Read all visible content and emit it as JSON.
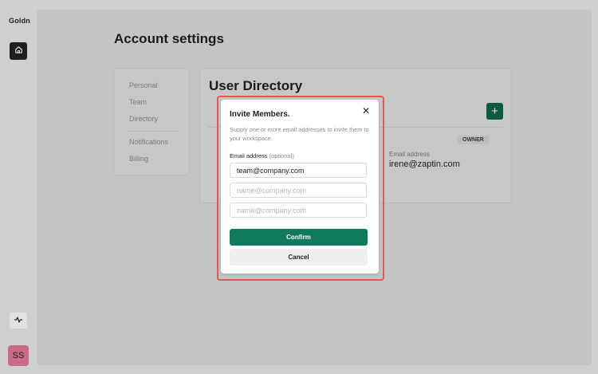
{
  "app": {
    "logo": "Goldn"
  },
  "sidebar": {
    "home_icon": "home-icon",
    "activity_icon": "activity-icon",
    "avatar_initials": "SS",
    "avatar_color": "#c96b84"
  },
  "page": {
    "title": "Account settings"
  },
  "settings_nav": {
    "items": [
      "Personal",
      "Team",
      "Directory",
      "Notifications",
      "Billing"
    ]
  },
  "directory": {
    "title": "User Directory",
    "add_button": "+",
    "owner_badge": "OWNER",
    "email_label": "Email address",
    "email_value": "irene@zaptin.com"
  },
  "modal": {
    "title": "Invite Members.",
    "close": "✕",
    "description": "Supply one or more email addresses to invite them to your workspace.",
    "field_label": "Email address",
    "field_optional": "(optional)",
    "inputs": [
      {
        "value": "team@company.com",
        "placeholder": ""
      },
      {
        "value": "",
        "placeholder": "name@company.com"
      },
      {
        "value": "",
        "placeholder": "name@company.com"
      }
    ],
    "confirm_label": "Confirm",
    "cancel_label": "Cancel"
  },
  "colors": {
    "accent": "#0f7a5c",
    "highlight": "#e8564f"
  }
}
